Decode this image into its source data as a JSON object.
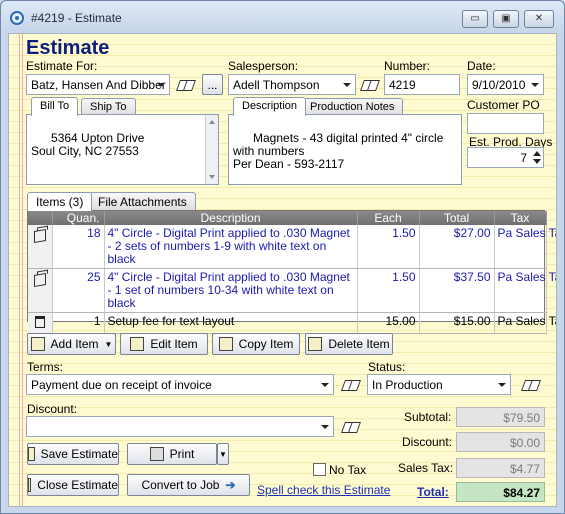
{
  "window": {
    "title": "#4219 - Estimate",
    "min_glyph": "▭",
    "max_glyph": "▣",
    "close_glyph": "✕"
  },
  "heading": "Estimate",
  "estimate_for": {
    "label": "Estimate For:",
    "value": "Batz, Hansen And Dibber",
    "more_label": "..."
  },
  "salesperson": {
    "label": "Salesperson:",
    "value": "Adell Thompson"
  },
  "number": {
    "label": "Number:",
    "value": "4219"
  },
  "date": {
    "label": "Date:",
    "value": "9/10/2010"
  },
  "address_tabs": [
    {
      "label": "Bill To"
    },
    {
      "label": "Ship To"
    }
  ],
  "bill_to": "5364 Upton Drive\nSoul City, NC 27553",
  "desc_tabs": [
    {
      "label": "Description"
    },
    {
      "label": "Production Notes"
    }
  ],
  "description": "Magnets - 43 digital printed 4\" circle with numbers\nPer Dean - 593-2117",
  "customer_po": {
    "label": "Customer PO",
    "value": ""
  },
  "est_prod_days": {
    "label": "Est. Prod. Days",
    "value": "7"
  },
  "items_tabs": [
    {
      "label": "Items (3)"
    },
    {
      "label": "File Attachments"
    }
  ],
  "grid": {
    "columns": [
      "Quan.",
      "Description",
      "Each",
      "Total",
      "Tax"
    ],
    "rows": [
      {
        "icon": "cube-icon",
        "quan": "18",
        "description": "4\" Circle - Digital Print applied to .030 Magnet - 2 sets of numbers 1-9 with white text on black",
        "each": "1.50",
        "total": "$27.00",
        "tax": "Pa Sales Tax",
        "style": "blue"
      },
      {
        "icon": "cube-icon",
        "quan": "25",
        "description": "4\" Circle - Digital Print applied to .030 Magnet - 1 set of numbers 10-34 with white text on black",
        "each": "1.50",
        "total": "$37.50",
        "tax": "Pa Sales Tax",
        "style": "blue"
      },
      {
        "icon": "chair-icon",
        "quan": "1",
        "description": "Setup fee for text layout",
        "each": "15.00",
        "total": "$15.00",
        "tax": "Pa Sales Tax",
        "style": "black"
      }
    ]
  },
  "item_buttons": {
    "add": "Add Item",
    "edit": "Edit Item",
    "copy": "Copy Item",
    "delete": "Delete Item"
  },
  "terms": {
    "label": "Terms:",
    "value": "Payment due on receipt of invoice"
  },
  "status": {
    "label": "Status:",
    "value": "In Production"
  },
  "discount": {
    "label": "Discount:",
    "value": ""
  },
  "summary": {
    "subtotal_label": "Subtotal:",
    "subtotal": "$79.50",
    "discount_label": "Discount:",
    "discount": "$0.00",
    "sales_tax_label": "Sales Tax:",
    "sales_tax": "$4.77",
    "total_label": "Total:",
    "total": "$84.27"
  },
  "no_tax_label": "No Tax",
  "bottom_buttons": {
    "save": "Save Estimate",
    "print": "Print",
    "close": "Close Estimate",
    "convert": "Convert to Job"
  },
  "spell_check_link": "Spell check this Estimate"
}
